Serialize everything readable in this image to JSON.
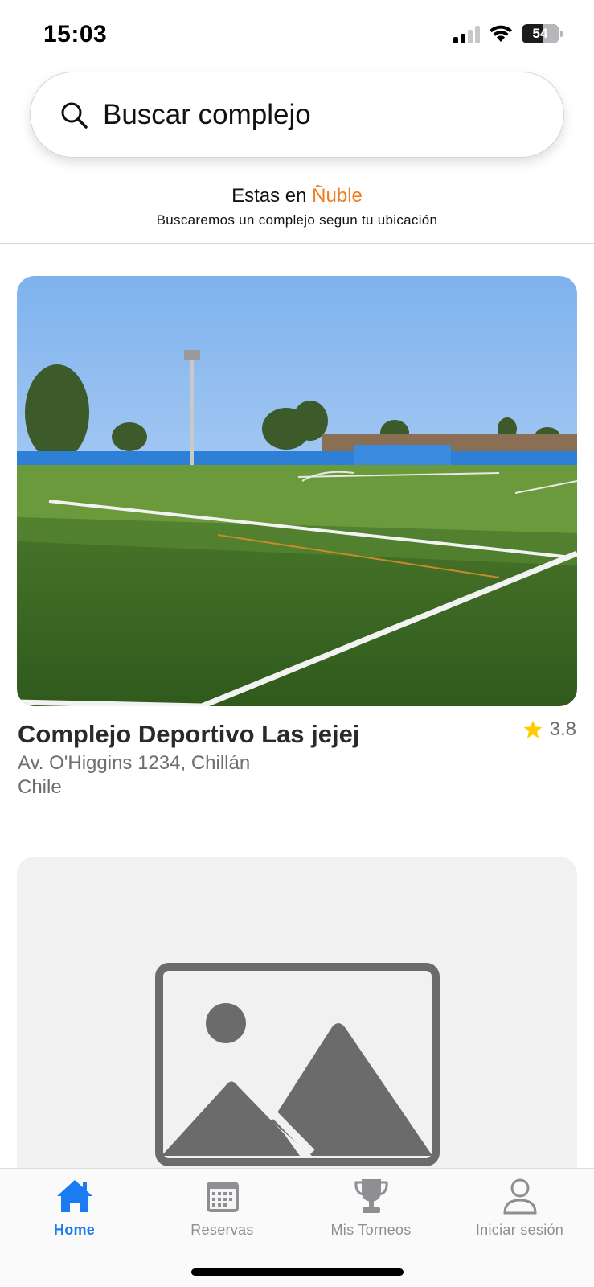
{
  "status_bar": {
    "time": "15:03",
    "battery": "54",
    "icons": [
      "cellular-signal-icon",
      "wifi-icon",
      "battery-icon"
    ]
  },
  "search": {
    "placeholder": "Buscar complejo",
    "icon": "search-icon"
  },
  "location": {
    "prefix": "Estas en ",
    "region": "Ñuble",
    "subtitle": "Buscaremos un complejo segun tu ubicación",
    "region_color": "#f07d1f"
  },
  "complexes": [
    {
      "name": "Complejo Deportivo Las jejej",
      "rating": "3.8",
      "address_line1": "Av. O'Higgins 1234, Chillán",
      "address_line2": "Chile",
      "image": "soccer-field-photo"
    },
    {
      "image": "image-placeholder-icon"
    }
  ],
  "tabs": [
    {
      "label": "Home",
      "icon": "home-icon",
      "active": true
    },
    {
      "label": "Reservas",
      "icon": "calendar-icon",
      "active": false
    },
    {
      "label": "Mis Torneos",
      "icon": "trophy-icon",
      "active": false
    },
    {
      "label": "Iniciar sesión",
      "icon": "person-icon",
      "active": false
    }
  ],
  "colors": {
    "accent": "#1a7cf2",
    "inactive": "#8e8e93",
    "star": "#ffcc00",
    "region": "#f07d1f"
  }
}
